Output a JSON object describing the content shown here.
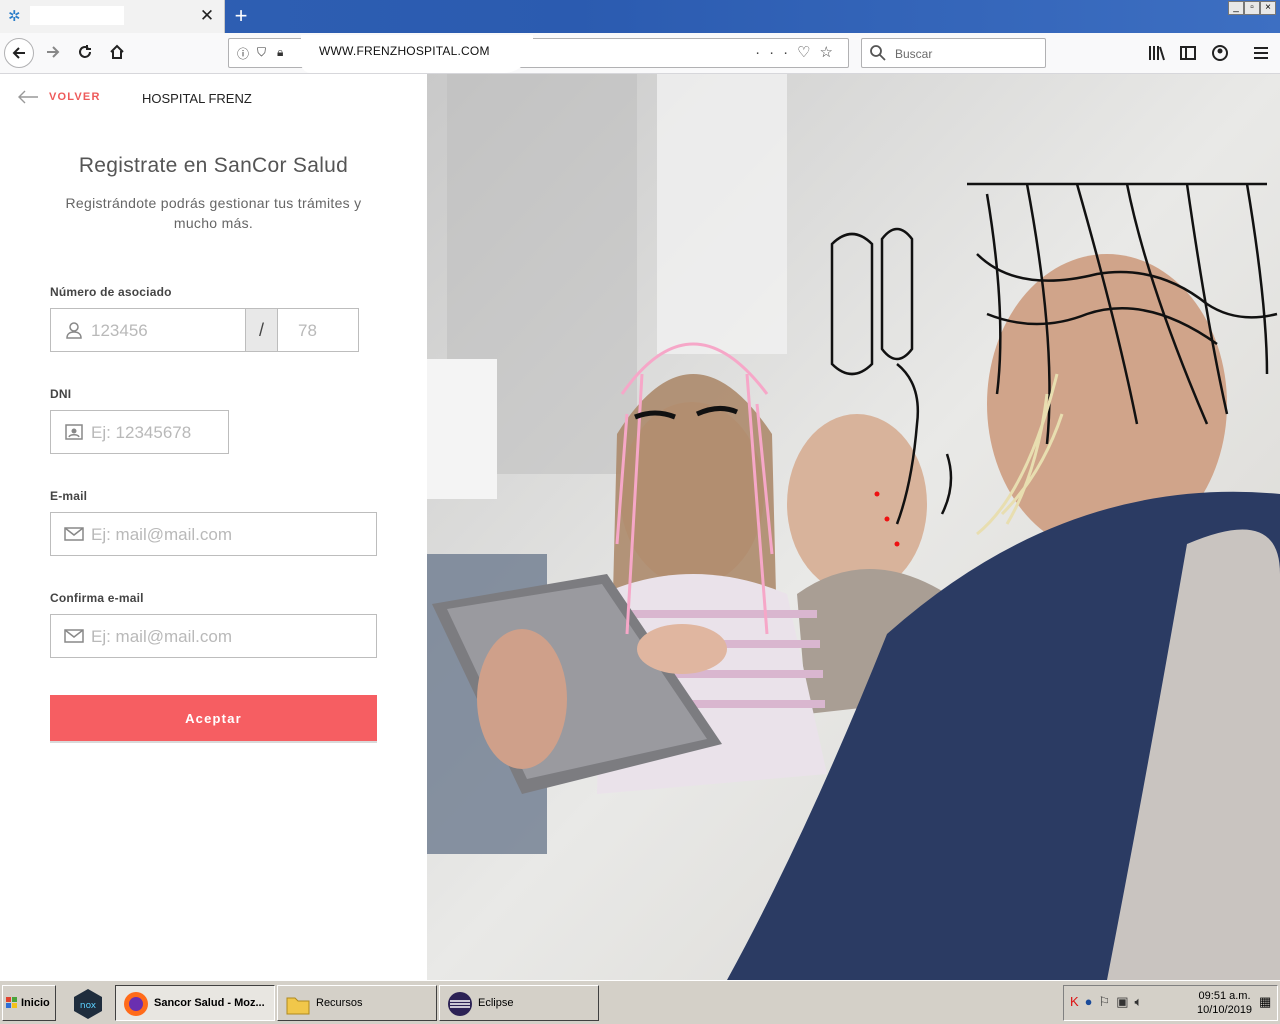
{
  "browser": {
    "tab_close": "✕",
    "new_tab": "+",
    "url": "WWW.FRENZHOSPITAL.COM",
    "search_placeholder": "Buscar",
    "window_controls": [
      "_",
      "▫",
      "×"
    ]
  },
  "page": {
    "back_label": "VOLVER",
    "brand": "HOSPITAL FRENZ",
    "title": "Registrate en SanCor Salud",
    "subtitle": "Registrándote podrás gestionar tus trámites y mucho más.",
    "fields": {
      "associate_label": "Número de asociado",
      "associate_placeholder": "123456",
      "associate_separator": "/",
      "associate_suffix_placeholder": "78",
      "dni_label": "DNI",
      "dni_placeholder": "Ej: 12345678",
      "email_label": "E-mail",
      "email_placeholder": "Ej: mail@mail.com",
      "confirm_label": "Confirma e-mail",
      "confirm_placeholder": "Ej: mail@mail.com"
    },
    "submit_label": "Aceptar",
    "accent_color": "#f65e62"
  },
  "taskbar": {
    "start_label": "Inicio",
    "items": [
      "Sancor Salud - Moz...",
      "Recursos",
      "Eclipse"
    ],
    "clock_time": "09:51 a.m.",
    "clock_date": "10/10/2019"
  }
}
